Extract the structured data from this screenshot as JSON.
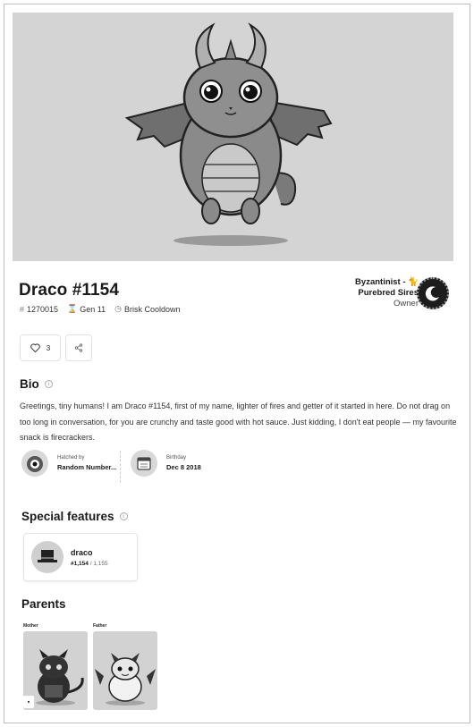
{
  "cat": {
    "title": "Draco #1154",
    "id": "1270015",
    "generation": "Gen 11",
    "cooldown": "Brisk Cooldown"
  },
  "owner": {
    "name_line1": "Byzantinist - 🐈",
    "name_line2": "Purebred Sires",
    "role": "Owner"
  },
  "actions": {
    "like_count": "3"
  },
  "bio": {
    "heading": "Bio",
    "text": "Greetings, tiny humans! I am Draco #1154, first of my name, lighter of fires and getter of it started in here. Do not drag on too long in conversation, for you are crunchy and taste good with hot sauce. Just kidding, I don't eat people — my favourite snack is firecrackers."
  },
  "hatched": {
    "label": "Hatched by",
    "value": "Random Number..."
  },
  "birthday": {
    "label": "Birthday",
    "value": "Dec 8 2018"
  },
  "special": {
    "heading": "Special features",
    "feature_name": "draco",
    "feature_rank": "#1,154",
    "feature_total": "/ 1,155"
  },
  "parents": {
    "heading": "Parents",
    "mother_label": "Mother",
    "father_label": "Father"
  },
  "icons": {
    "id": "hash-icon",
    "gen": "hourglass-icon",
    "cooldown": "clock-icon",
    "like": "heart-icon",
    "share": "share-icon",
    "info": "info-icon"
  }
}
